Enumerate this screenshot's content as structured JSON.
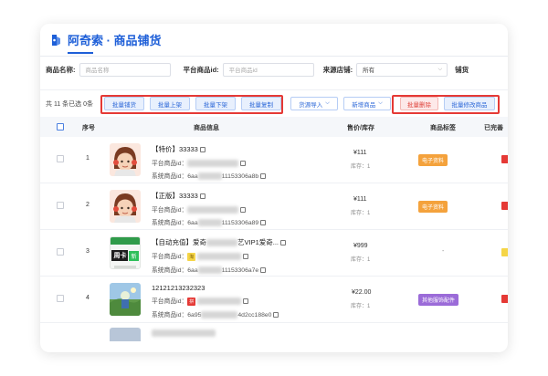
{
  "app": {
    "title": "阿奇索 · 商品铺货"
  },
  "filters": {
    "name_label": "商品名称:",
    "name_placeholder": "商品名称",
    "platform_id_label": "平台商品id:",
    "platform_id_placeholder": "平台商品id",
    "source_store_label": "来源店铺:",
    "source_store_value": "所有",
    "cut_label": "铺货"
  },
  "toolbar": {
    "summary": "共 11 条已选 0条",
    "btn_batch_distribute": "批量铺货",
    "btn_batch_on_shelf": "批量上架",
    "btn_batch_off_shelf": "批量下架",
    "btn_batch_copy": "批量复制",
    "btn_source_import": "货源导入",
    "btn_add_product": "新增商品",
    "btn_batch_delete": "批量删除",
    "btn_batch_edit": "批量修改商品"
  },
  "table": {
    "columns": {
      "seq": "序号",
      "info": "商品信息",
      "price": "售价/库存",
      "tags": "商品标签",
      "complete": "已完善"
    },
    "rows": [
      {
        "seq": "1",
        "title": "【特价】33333",
        "platform_label": "平台商品id：",
        "system_label": "系统商品id：",
        "system_id_prefix": "6aa",
        "system_id_suffix": "11153306a8b",
        "price": "¥111",
        "stock": "库存：1",
        "tag": "电子资料",
        "mini_tag": "",
        "thumb": "avatar"
      },
      {
        "seq": "2",
        "title": "【正版】33333",
        "platform_label": "平台商品id：",
        "system_label": "系统商品id：",
        "system_id_prefix": "6aa",
        "system_id_suffix": "11153306a89",
        "price": "¥111",
        "stock": "库存：1",
        "tag": "电子资料",
        "mini_tag": "",
        "thumb": "avatar"
      },
      {
        "seq": "3",
        "title": "【自动充值】爱奇",
        "title_suffix": "艺VIP1爱奇...",
        "platform_label": "平台商品id：",
        "system_label": "系统商品id：",
        "system_id_prefix": "6aa",
        "system_id_suffix": "11153306a7e",
        "price": "¥999",
        "stock": "库存：1",
        "tag": "-",
        "mini_tag": "",
        "thumb_top": "周卡",
        "thumb_badge": "新",
        "thumb": "card"
      },
      {
        "seq": "4",
        "title": "12121213232323",
        "platform_label": "平台商品id：",
        "system_label": "系统商品id：",
        "system_id_prefix": "6a95",
        "system_id_suffix": "4d2cc188e0",
        "price": "¥22.00",
        "stock": "库存：1",
        "tag": "其他服饰配件",
        "mini_tag": "",
        "thumb": "photo"
      }
    ]
  },
  "colors": {
    "accent": "#1e5fd8",
    "highlight_box": "#e53935",
    "tag_orange": "#f4a23c",
    "tag_purple": "#9b6bd8"
  }
}
